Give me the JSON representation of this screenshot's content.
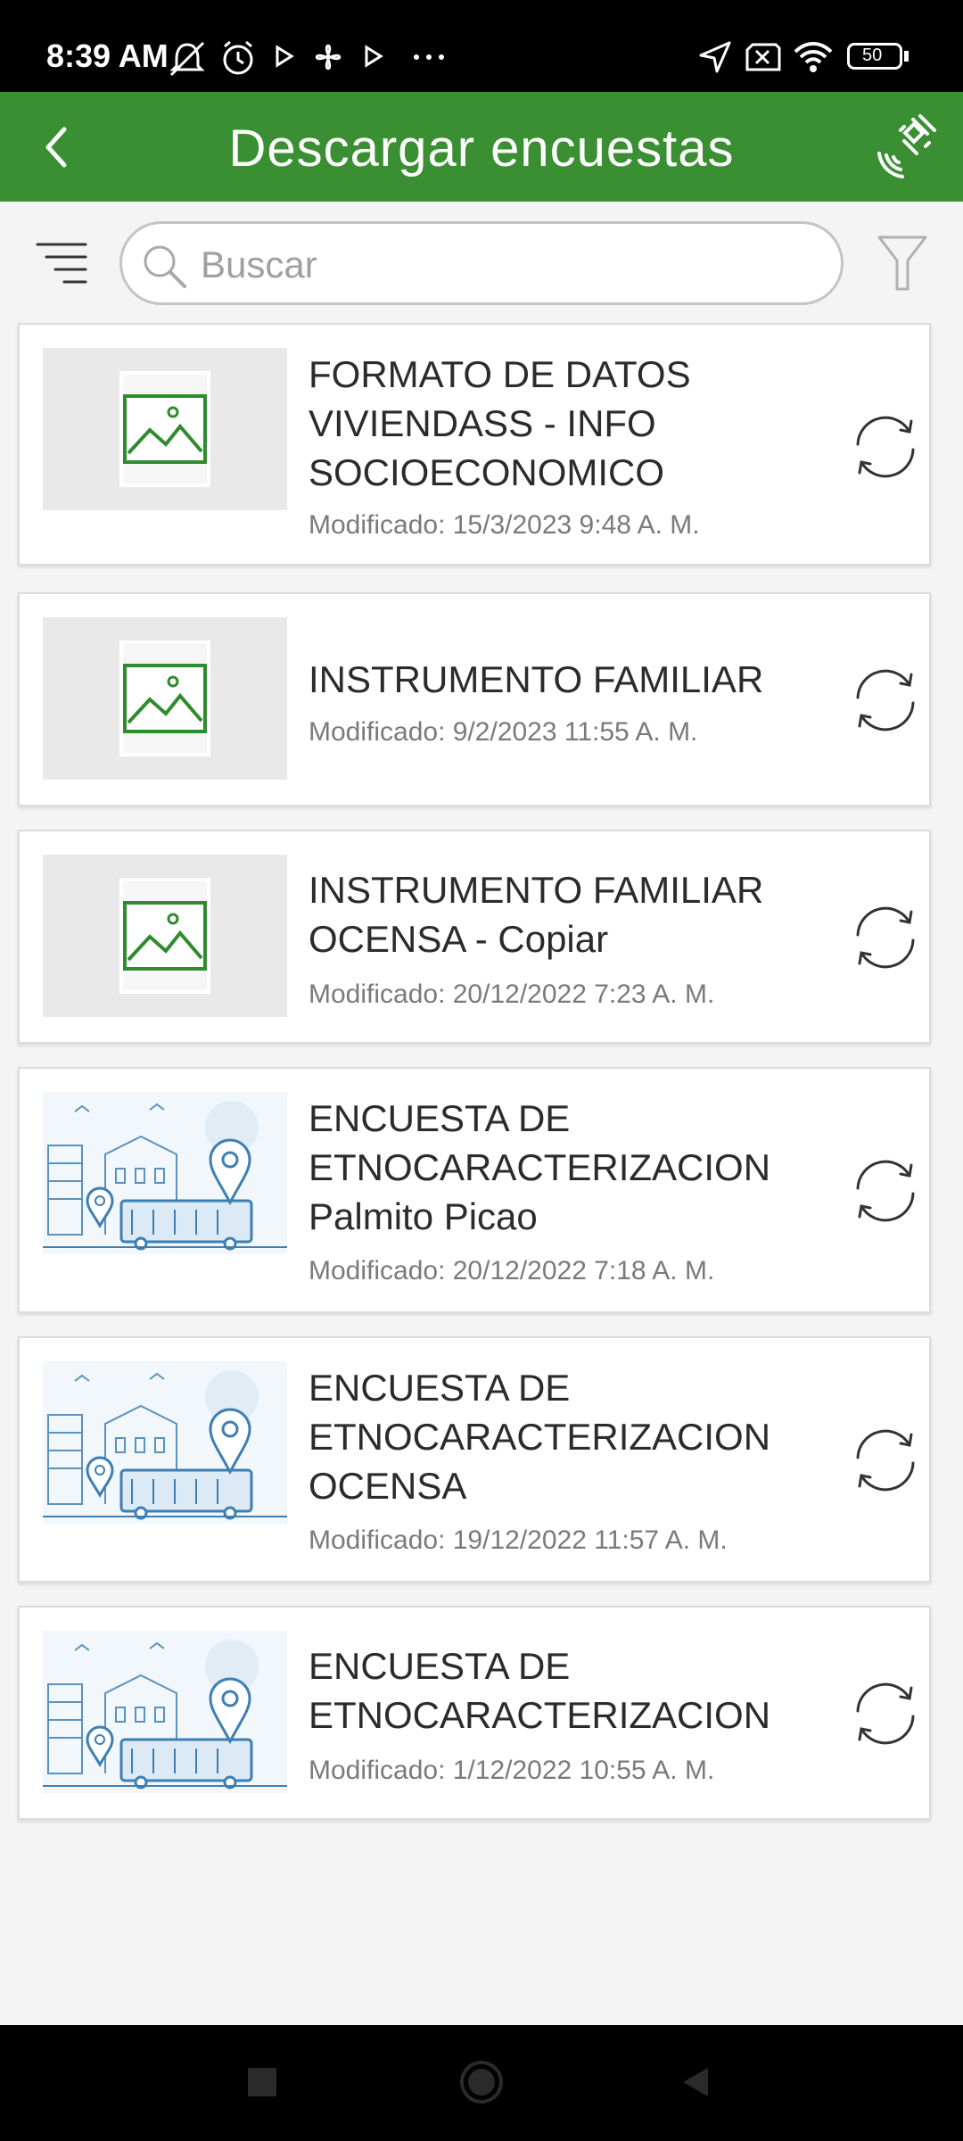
{
  "status_bar": {
    "time": "8:39 AM",
    "battery": "50"
  },
  "header": {
    "title": "Descargar encuestas"
  },
  "search": {
    "placeholder": "Buscar"
  },
  "surveys": [
    {
      "title": "FORMATO DE DATOS\nVIVIENDASS -  INFO\nSOCIOECONOMICO",
      "modified": "Modificado: 15/3/2023 9:48 A. M.",
      "thumbnail": "image-placeholder-icon"
    },
    {
      "title": "INSTRUMENTO FAMILIAR",
      "modified": "Modificado: 9/2/2023 11:55 A. M.",
      "thumbnail": "image-placeholder-icon"
    },
    {
      "title": "INSTRUMENTO FAMILIAR\nOCENSA - Copiar",
      "modified": "Modificado: 20/12/2022 7:23 A. M.",
      "thumbnail": "image-placeholder-icon"
    },
    {
      "title": "ENCUESTA DE\nETNOCARACTERIZACION\nPalmito Picao",
      "modified": "Modificado: 20/12/2022 7:18 A. M.",
      "thumbnail": "city-bus-illustration"
    },
    {
      "title": "ENCUESTA DE\nETNOCARACTERIZACION\nOCENSA",
      "modified": "Modificado: 19/12/2022 11:57 A. M.",
      "thumbnail": "city-bus-illustration"
    },
    {
      "title": "ENCUESTA DE\nETNOCARACTERIZACION",
      "modified": "Modificado: 1/12/2022 10:55 A. M.",
      "thumbnail": "city-bus-illustration"
    }
  ],
  "colors": {
    "accent": "#3b8f33",
    "background": "#f4f4f4",
    "text": "#2b2b2b",
    "muted": "#7a7a7a"
  }
}
